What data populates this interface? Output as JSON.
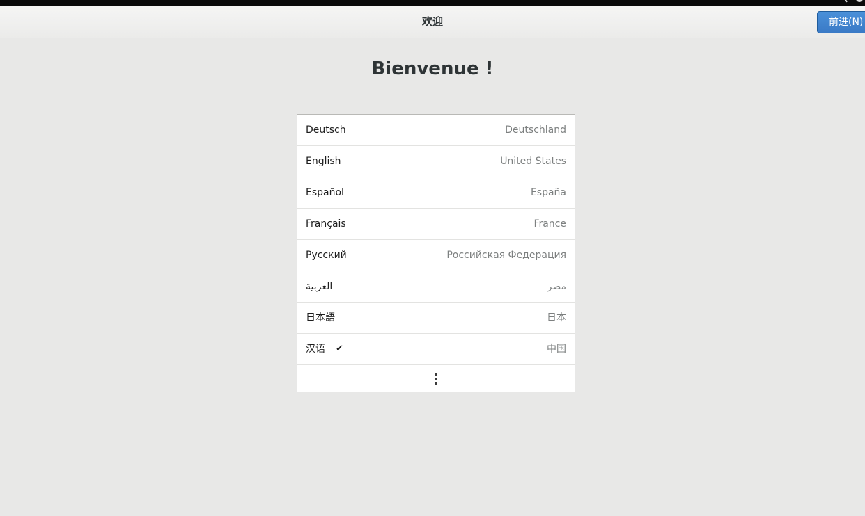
{
  "header": {
    "title": "欢迎",
    "next_button_label": "前进(N)"
  },
  "welcome_title": "Bienvenue !",
  "languages": [
    {
      "name": "Deutsch",
      "region": "Deutschland"
    },
    {
      "name": "English",
      "region": "United States"
    },
    {
      "name": "Español",
      "region": "España"
    },
    {
      "name": "Français",
      "region": "France"
    },
    {
      "name": "Русский",
      "region": "Российская Федерация"
    },
    {
      "name": "العربية",
      "region": "مصر"
    },
    {
      "name": "日本語",
      "region": "日本"
    },
    {
      "name": "汉语",
      "region": "中国",
      "selected": true
    }
  ],
  "icons": {
    "check": "checkmark-icon",
    "more": "more-vertical-icon"
  },
  "colors": {
    "accent": "#4a90d9",
    "background": "#e8e8e7"
  }
}
